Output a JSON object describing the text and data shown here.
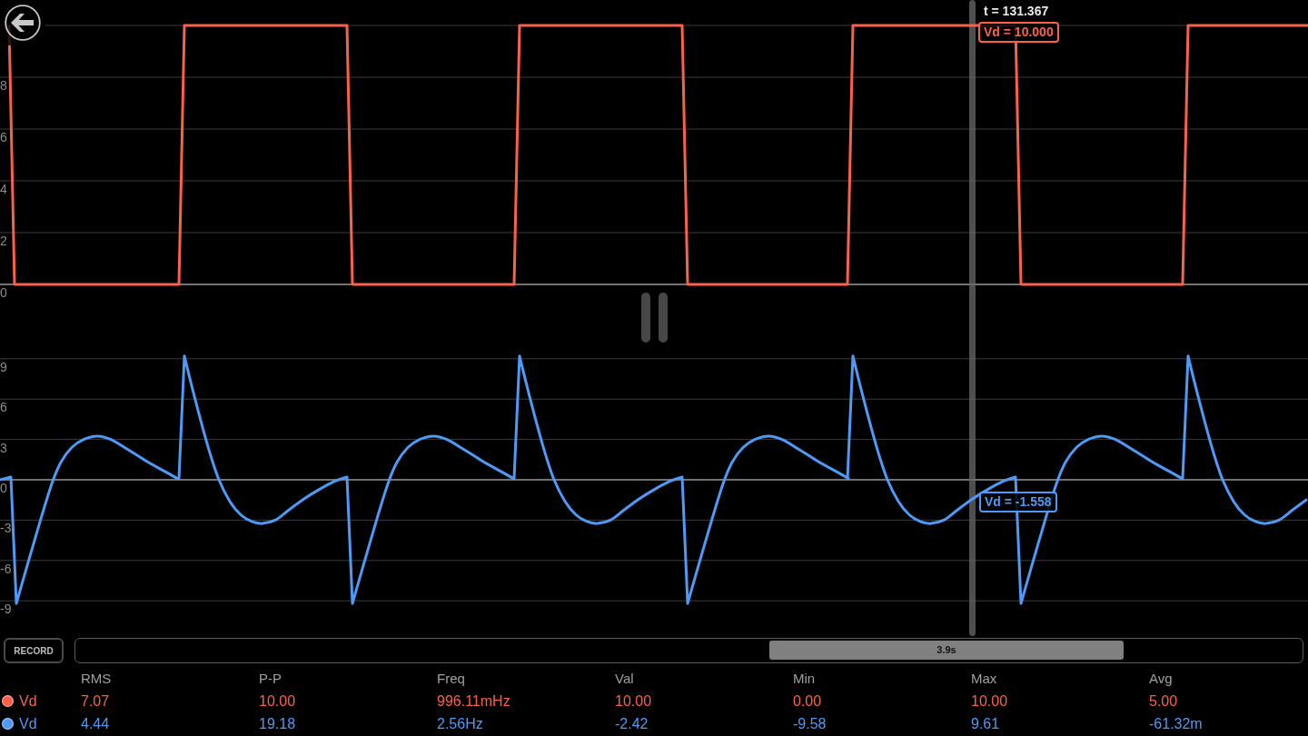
{
  "plots": [
    {
      "kind": "square",
      "color": "#fb6149",
      "y_axis_labels": [
        "8",
        "6",
        "4",
        "2",
        "0"
      ],
      "readout": "Vd = 10.000"
    },
    {
      "kind": "response",
      "color": "#4d9bf7",
      "y_axis_labels": [
        "9",
        "6",
        "3",
        "0",
        "-3",
        "-6",
        "-9"
      ],
      "readout": "Vd = -1.558"
    }
  ],
  "cursor": {
    "time": "t = 131.367"
  },
  "record_button": {
    "label": "RECORD"
  },
  "timeline": {
    "window": "3.9s"
  },
  "stats": {
    "columns": [
      "RMS",
      "P-P",
      "Freq",
      "Val",
      "Min",
      "Max",
      "Avg"
    ],
    "rows": [
      {
        "name": "Vd",
        "color": "#fb6149",
        "values": [
          "7.07",
          "10.00",
          "996.11mHz",
          "10.00",
          "0.00",
          "10.00",
          "5.00"
        ]
      },
      {
        "name": "Vd",
        "color": "#4d9bf7",
        "values": [
          "4.44",
          "19.18",
          "2.56Hz",
          "-2.42",
          "-9.58",
          "9.61",
          "-61.32m"
        ]
      }
    ]
  }
}
